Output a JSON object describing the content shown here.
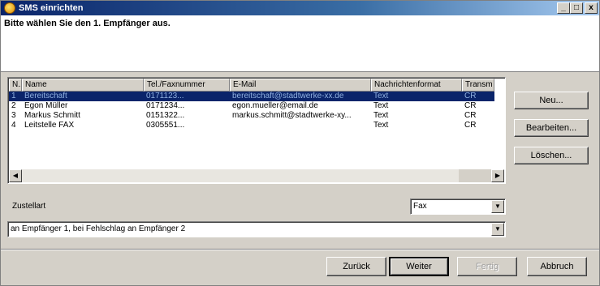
{
  "window": {
    "title": "SMS einrichten",
    "caption_minimize": "_",
    "caption_maximize": "□",
    "caption_close": "x"
  },
  "header": {
    "instruction": "Bitte wählen Sie den 1. Empfänger aus."
  },
  "list": {
    "columns": [
      "N..",
      "Name",
      "Tel./Faxnummer",
      "E-Mail",
      "Nachrichtenformat",
      "Transm"
    ],
    "rows": [
      {
        "n": "1",
        "name": "Bereitschaft",
        "tel": "0171123...",
        "email": "bereitschaft@stadtwerke-xx.de",
        "format": "Text",
        "trans": "CR"
      },
      {
        "n": "2",
        "name": "Egon Müller",
        "tel": "0171234...",
        "email": "egon.mueller@email.de",
        "format": "Text",
        "trans": "CR"
      },
      {
        "n": "3",
        "name": "Markus Schmitt",
        "tel": "0151322...",
        "email": "markus.schmitt@stadtwerke-xy...",
        "format": "Text",
        "trans": "CR"
      },
      {
        "n": "4",
        "name": "Leitstelle FAX",
        "tel": "0305551...",
        "email": "",
        "format": "Text",
        "trans": "CR"
      }
    ],
    "selected_index": 0
  },
  "side_buttons": {
    "new": "Neu...",
    "edit": "Bearbeiten...",
    "delete": "Löschen..."
  },
  "delivery": {
    "label": "Zustellart",
    "type_value": "Fax",
    "mode_value": "an Empfänger 1, bei Fehlschlag an Empfänger 2"
  },
  "buttons": {
    "back": "Zurück",
    "next": "Weiter",
    "finish": "Fertig",
    "cancel": "Abbruch"
  },
  "colors": {
    "title_start": "#0a246a",
    "selection": "#0a246a",
    "face": "#d4d0c8"
  }
}
